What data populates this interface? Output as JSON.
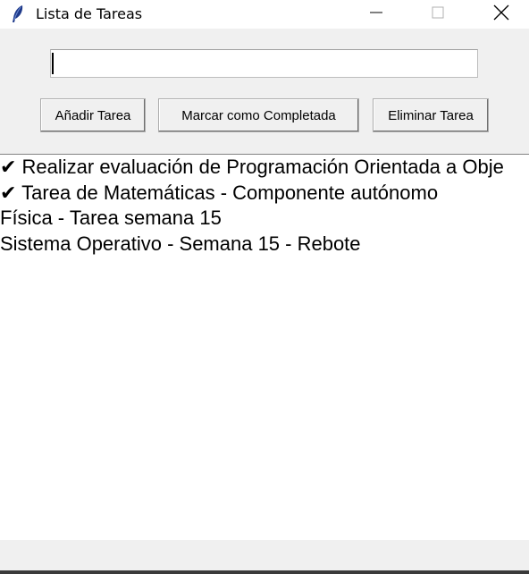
{
  "window": {
    "title": "Lista de Tareas"
  },
  "entry": {
    "value": ""
  },
  "buttons": {
    "add": "Añadir Tarea",
    "mark": "Marcar como Completada",
    "delete": "Eliminar Tarea"
  },
  "tasks": [
    "✔ Realizar evaluación de Programación Orientada a Obje",
    "✔ Tarea de Matemáticas - Componente autónomo",
    "Física - Tarea semana 15",
    "Sistema Operativo - Semana 15 - Rebote"
  ]
}
